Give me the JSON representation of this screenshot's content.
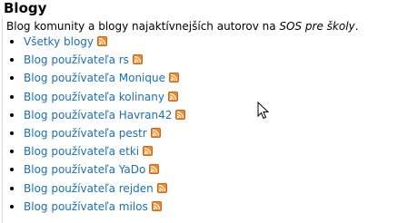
{
  "title": "Blogy",
  "intro": {
    "text_before": "Blog komunity a blogy najaktívnejších autorov na ",
    "site_name": "SOS pre školy",
    "text_after": "."
  },
  "links": [
    {
      "label": "Všetky blogy"
    },
    {
      "label": "Blog používateľa rs"
    },
    {
      "label": "Blog používateľa Monique"
    },
    {
      "label": "Blog používateľa kolinany"
    },
    {
      "label": "Blog používateľa Havran42"
    },
    {
      "label": "Blog používateľa pestr"
    },
    {
      "label": "Blog používateľa etki"
    },
    {
      "label": "Blog používateľa YaDo"
    },
    {
      "label": "Blog používateľa rejden"
    },
    {
      "label": "Blog používateľa milos"
    }
  ],
  "icons": {
    "feed": "rss-feed-icon",
    "pointer": "mouse-cursor-icon"
  },
  "colors": {
    "link": "#1a6fb5",
    "rss": "#f28a2c"
  }
}
